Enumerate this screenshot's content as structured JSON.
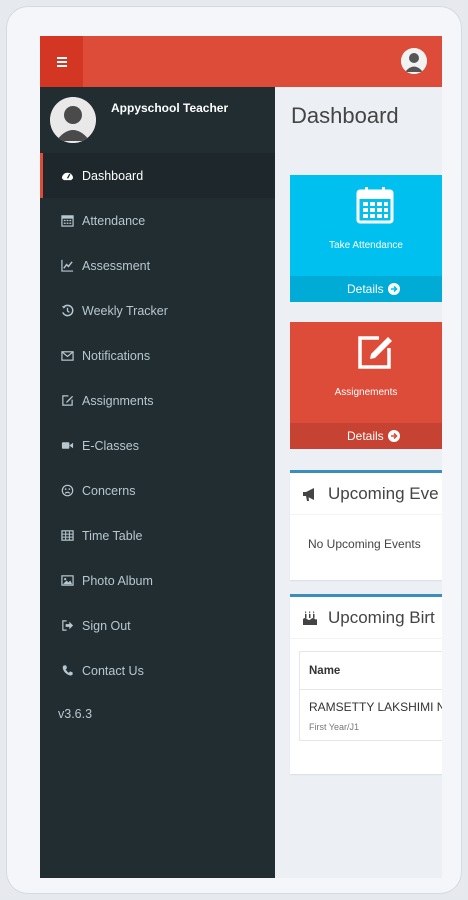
{
  "header": {
    "menu_icon": "hamburger-icon",
    "user_icon": "user-avatar-icon",
    "accent_color": "#dd4b39"
  },
  "sidebar": {
    "user_name": "Appyschool Teacher",
    "items": [
      {
        "label": "Dashboard",
        "icon": "dashboard-icon",
        "active": true
      },
      {
        "label": "Attendance",
        "icon": "calendar-icon"
      },
      {
        "label": "Assessment",
        "icon": "line-chart-icon"
      },
      {
        "label": "Weekly Tracker",
        "icon": "history-icon"
      },
      {
        "label": "Notifications",
        "icon": "envelope-icon"
      },
      {
        "label": "Assignments",
        "icon": "edit-icon"
      },
      {
        "label": "E-Classes",
        "icon": "video-camera-icon"
      },
      {
        "label": "Concerns",
        "icon": "frown-icon"
      },
      {
        "label": "Time Table",
        "icon": "table-icon"
      },
      {
        "label": "Photo Album",
        "icon": "picture-icon"
      },
      {
        "label": "Sign Out",
        "icon": "sign-out-icon"
      },
      {
        "label": "Contact Us",
        "icon": "phone-icon"
      }
    ],
    "version": "v3.6.3",
    "bg_color": "#222d32"
  },
  "main": {
    "title": "Dashboard",
    "tiles": [
      {
        "label": "Take Attendance",
        "details": "Details",
        "icon": "calendar-icon",
        "color": "#00c0ef"
      },
      {
        "label": "Assignements",
        "details": "Details",
        "icon": "edit-icon",
        "color": "#dd4b39"
      }
    ],
    "events": {
      "title": "Upcoming Eve",
      "icon": "bullhorn-icon",
      "empty_text": "No Upcoming Events"
    },
    "birthdays": {
      "title": "Upcoming Birt",
      "icon": "birthday-cake-icon",
      "column": "Name",
      "rows": [
        {
          "name": "RAMSETTY LAKSHIMI N",
          "class": "First Year/J1"
        }
      ]
    }
  }
}
